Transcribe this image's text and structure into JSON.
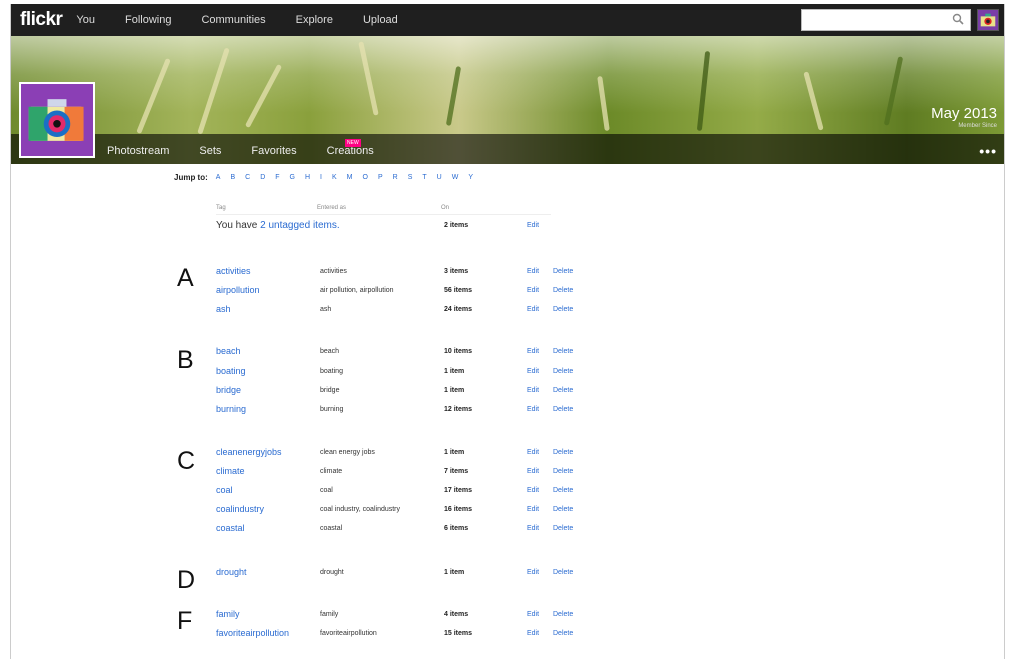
{
  "topnav": {
    "logo": "flickr",
    "links": [
      "You",
      "Following",
      "Communities",
      "Explore",
      "Upload"
    ],
    "search_placeholder": ""
  },
  "profile": {
    "subnav": [
      "Photostream",
      "Sets",
      "Favorites",
      "Creations"
    ],
    "new_badge": "NEW",
    "member_since_date": "May 2013",
    "member_since_label": "Member Since",
    "more": "•••"
  },
  "jump": {
    "label": "Jump to:",
    "letters": [
      "A",
      "B",
      "C",
      "D",
      "F",
      "G",
      "H",
      "I",
      "K",
      "M",
      "O",
      "P",
      "R",
      "S",
      "T",
      "U",
      "W",
      "Y"
    ]
  },
  "table": {
    "headers": {
      "tag": "Tag",
      "entered": "Entered as",
      "on": "On"
    },
    "untagged": {
      "prefix": "You have ",
      "link": "2 untagged items.",
      "count": "2 items",
      "edit": "Edit"
    },
    "edit_label": "Edit",
    "delete_label": "Delete",
    "groups": [
      {
        "letter": "A",
        "rows": [
          {
            "tag": "activities",
            "entered": "activities",
            "count": "3 items"
          },
          {
            "tag": "airpollution",
            "entered": "air pollution, airpollution",
            "count": "56 items"
          },
          {
            "tag": "ash",
            "entered": "ash",
            "count": "24 items"
          }
        ]
      },
      {
        "letter": "B",
        "rows": [
          {
            "tag": "beach",
            "entered": "beach",
            "count": "10 items"
          },
          {
            "tag": "boating",
            "entered": "boating",
            "count": "1 item"
          },
          {
            "tag": "bridge",
            "entered": "bridge",
            "count": "1 item"
          },
          {
            "tag": "burning",
            "entered": "burning",
            "count": "12 items"
          }
        ]
      },
      {
        "letter": "C",
        "rows": [
          {
            "tag": "cleanenergyjobs",
            "entered": "clean energy jobs",
            "count": "1 item"
          },
          {
            "tag": "climate",
            "entered": "climate",
            "count": "7 items"
          },
          {
            "tag": "coal",
            "entered": "coal",
            "count": "17 items"
          },
          {
            "tag": "coalindustry",
            "entered": "coal industry, coalindustry",
            "count": "16 items"
          },
          {
            "tag": "coastal",
            "entered": "coastal",
            "count": "6 items"
          }
        ]
      },
      {
        "letter": "D",
        "rows": [
          {
            "tag": "drought",
            "entered": "drought",
            "count": "1 item"
          }
        ]
      },
      {
        "letter": "F",
        "rows": [
          {
            "tag": "family",
            "entered": "family",
            "count": "4 items"
          },
          {
            "tag": "favoriteairpollution",
            "entered": "favoriteairpollution",
            "count": "15 items"
          }
        ]
      }
    ]
  }
}
